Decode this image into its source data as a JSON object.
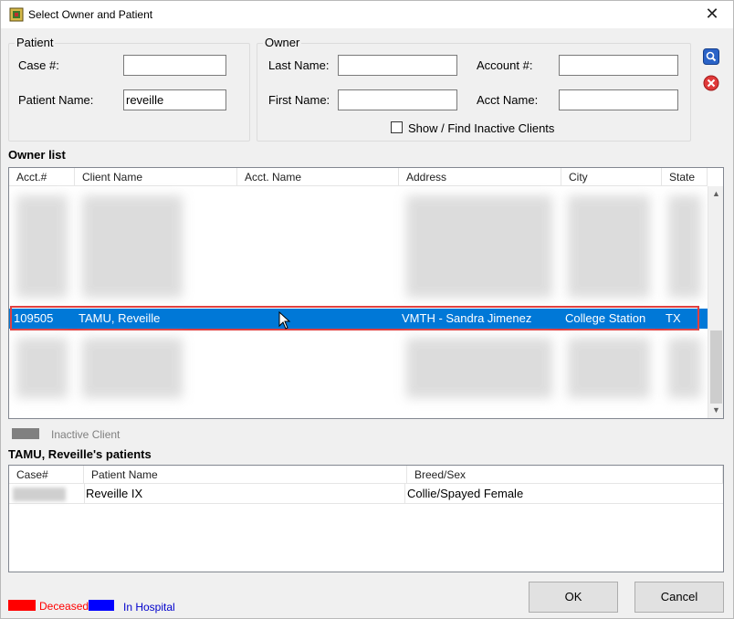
{
  "window": {
    "title": "Select Owner and Patient"
  },
  "patient_group": {
    "legend": "Patient",
    "case_label": "Case #:",
    "case_value": "",
    "name_label": "Patient Name:",
    "name_value": "reveille"
  },
  "owner_group": {
    "legend": "Owner",
    "last_name_label": "Last Name:",
    "last_name_value": "",
    "first_name_label": "First Name:",
    "first_name_value": "",
    "account_label": "Account #:",
    "account_value": "",
    "acct_name_label": "Acct Name:",
    "acct_name_value": "",
    "inactive_checkbox_label": "Show / Find Inactive Clients",
    "inactive_checked": false
  },
  "side_buttons": {
    "search_icon": "magnifier-icon",
    "clear_icon": "red-x-icon"
  },
  "owner_list": {
    "title": "Owner list",
    "columns": [
      "Acct.#",
      "Client Name",
      "Acct. Name",
      "Address",
      "City",
      "State"
    ],
    "selected_row": {
      "acct": "109505",
      "client_name": "TAMU, Reveille",
      "acct_name": "",
      "address": "VMTH - Sandra Jimenez",
      "city": "College Station",
      "state": "TX"
    }
  },
  "inactive_legend": {
    "label": "Inactive Client",
    "color": "#808080"
  },
  "patients": {
    "title": "TAMU, Reveille's patients",
    "columns": [
      "Case#",
      "Patient Name",
      "Breed/Sex"
    ],
    "rows": [
      {
        "case": "",
        "name": "Reveille IX",
        "breed_sex": "Collie/Spayed Female"
      }
    ]
  },
  "status_legend": {
    "deceased_label": "Deceased",
    "deceased_color": "#ff0000",
    "hospital_label": "In Hospital",
    "hospital_color": "#0000ff"
  },
  "buttons": {
    "ok": "OK",
    "cancel": "Cancel"
  },
  "colors": {
    "selection": "#0078d7",
    "highlight_border": "#e04040"
  }
}
